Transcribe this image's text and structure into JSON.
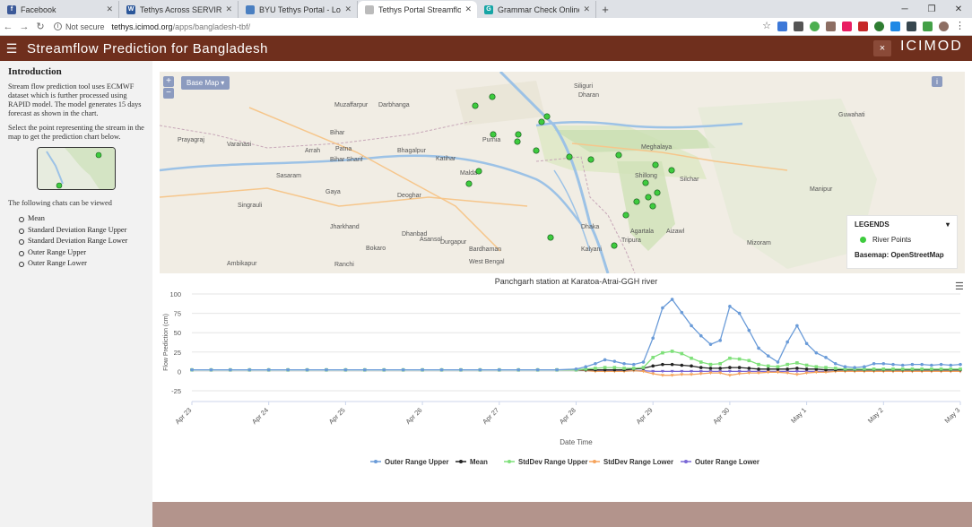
{
  "browser": {
    "tabs": [
      {
        "label": "Facebook",
        "fav_color": "#3b5998",
        "fav_glyph": "f",
        "active": false
      },
      {
        "label": "Tethys Across SERVIR - Frontiers",
        "fav_color": "#2b579a",
        "fav_glyph": "W",
        "active": false
      },
      {
        "label": "BYU Tethys Portal - Log In",
        "fav_color": "#4a7fc1",
        "fav_glyph": "",
        "active": false
      },
      {
        "label": "Tethys Portal Streamflow Predict",
        "fav_color": "#bbbbbb",
        "fav_glyph": "",
        "active": true
      },
      {
        "label": "Grammar Check Online- It's Free",
        "fav_color": "#16a5a5",
        "fav_glyph": "G",
        "active": false
      }
    ],
    "new_tab": "+",
    "window_controls": [
      "─",
      "❐",
      "✕"
    ],
    "security": "Not secure",
    "url_host": "tethys.icimod.org",
    "url_path": "/apps/bangladesh-tbf/"
  },
  "app": {
    "title": "Streamflow Prediction for Bangladesh",
    "logo": "ICIMOD",
    "close": "×"
  },
  "sidebar": {
    "heading": "Introduction",
    "para1": "Stream flow prediction tool uses ECMWF dataset which is further processed using RAPID model. The model generates 15 days forecast as shown in the chart.",
    "para2": "Select the point representing the stream in the map to get the prediction chart below.",
    "para3": "The following chats can be viewed",
    "items": [
      "Mean",
      "Standard Deviation Range Upper",
      "Standard Deviation Range Lower",
      "Outer Range Upper",
      "Outer Range Lower"
    ]
  },
  "map": {
    "zoom_in": "+",
    "zoom_out": "−",
    "base_map_label": "Base Map ▾",
    "info": "i",
    "legend_title": "LEGENDS",
    "legend_toggle": "▾",
    "legend_item": "River Points",
    "basemap_text": "Basemap: OpenStreetMap",
    "place_labels": [
      "Siliguri",
      "Dharan",
      "Muzaffarpur",
      "Darbhanga",
      "Prayagraj",
      "Varanasi",
      "Arrah",
      "Patna",
      "Bhagalpur",
      "Katihar",
      "Malda",
      "Guwahati",
      "Shillong",
      "Silchar",
      "Sasaram",
      "Gaya",
      "Deoghar",
      "Dhanbad",
      "Asansol",
      "Durgapur",
      "Bokaro",
      "Ranchi",
      "Agartala",
      "Aizawl",
      "Dhaka",
      "Bihar",
      "Meghalaya",
      "Manipur",
      "Mizoram",
      "Jharkhand",
      "West Bengal",
      "Tripura",
      "Singrauli",
      "Ambikapur",
      "Bardhaman",
      "Kalyani",
      "Bihar Sharif",
      "Purnia"
    ],
    "river_point_color": "#3ecb3e"
  },
  "chart_data": {
    "type": "line",
    "title": "Panchgarh station at Karatoa-Atrai-GGH river",
    "xlabel": "Date Time",
    "ylabel": "Flow Prediction (cm)",
    "ylim": [
      -25,
      100
    ],
    "yticks": [
      -25,
      0,
      25,
      50,
      75,
      100
    ],
    "xticks": [
      "Apr 23",
      "Apr 24",
      "Apr 25",
      "Apr 26",
      "Apr 27",
      "Apr 28",
      "Apr 29",
      "Apr 30",
      "May 1",
      "May 2",
      "May 3"
    ],
    "x_days": [
      0,
      0.25,
      0.5,
      0.75,
      1,
      1.25,
      1.5,
      1.75,
      2,
      2.25,
      2.5,
      2.75,
      3,
      3.25,
      3.5,
      3.75,
      4,
      4.25,
      4.5,
      4.75,
      5,
      5.125,
      5.25,
      5.375,
      5.5,
      5.625,
      5.75,
      5.875,
      6,
      6.125,
      6.25,
      6.375,
      6.5,
      6.625,
      6.75,
      6.875,
      7,
      7.125,
      7.25,
      7.375,
      7.5,
      7.625,
      7.75,
      7.875,
      8,
      8.125,
      8.25,
      8.375,
      8.5,
      8.625,
      8.75,
      8.875,
      9,
      9.125,
      9.25,
      9.375,
      9.5,
      9.625,
      9.75,
      9.875,
      10
    ],
    "series": [
      {
        "name": "Outer Range Upper",
        "color": "#6a9bd8",
        "values": [
          2,
          2,
          2,
          2,
          2,
          2,
          2,
          2,
          2,
          2,
          2,
          2,
          2,
          2,
          2,
          2,
          2,
          2,
          2,
          2,
          3,
          6,
          10,
          15,
          13,
          10,
          9,
          12,
          43,
          82,
          93,
          76,
          59,
          46,
          35,
          40,
          84,
          75,
          53,
          30,
          20,
          12,
          38,
          59,
          36,
          24,
          18,
          10,
          6,
          5,
          6,
          10,
          10,
          9,
          8,
          9,
          9,
          8,
          9,
          8,
          9
        ]
      },
      {
        "name": "Mean",
        "color": "#222222",
        "values": [
          2,
          2,
          2,
          2,
          2,
          2,
          2,
          2,
          2,
          2,
          2,
          2,
          2,
          2,
          2,
          2,
          2,
          2,
          2,
          2,
          2,
          2,
          2,
          2,
          2,
          2,
          3,
          4,
          7,
          9,
          9,
          8,
          7,
          5,
          4,
          4,
          5,
          5,
          4,
          3,
          3,
          3,
          3,
          4,
          3,
          3,
          2,
          2,
          2,
          2,
          2,
          2,
          2,
          2,
          2,
          2,
          2,
          2,
          2,
          2,
          2
        ]
      },
      {
        "name": "StdDev Range Upper",
        "color": "#7fe07a",
        "values": [
          2,
          2,
          2,
          2,
          2,
          2,
          2,
          2,
          2,
          2,
          2,
          2,
          2,
          2,
          2,
          2,
          2,
          2,
          2,
          2,
          2,
          3,
          4,
          5,
          5,
          4,
          4,
          5,
          18,
          24,
          26,
          23,
          17,
          12,
          9,
          10,
          17,
          16,
          14,
          9,
          7,
          6,
          9,
          11,
          8,
          6,
          5,
          4,
          3,
          3,
          3,
          3,
          3,
          3,
          3,
          3,
          3,
          3,
          3,
          3,
          3
        ]
      },
      {
        "name": "StdDev Range Lower",
        "color": "#f5a35c",
        "values": [
          2,
          2,
          2,
          2,
          2,
          2,
          2,
          2,
          2,
          2,
          2,
          2,
          2,
          2,
          2,
          2,
          2,
          2,
          2,
          2,
          2,
          1,
          0,
          0,
          0,
          0,
          1,
          0,
          -3,
          -5,
          -5,
          -4,
          -4,
          -3,
          -2,
          -2,
          -5,
          -3,
          -2,
          -2,
          -1,
          -1,
          -2,
          -4,
          -2,
          -1,
          -1,
          0,
          0,
          0,
          0,
          0,
          0,
          0,
          0,
          0,
          0,
          0,
          0,
          0,
          0
        ]
      },
      {
        "name": "Outer Range Lower",
        "color": "#7a68d6",
        "values": [
          2,
          2,
          2,
          2,
          2,
          2,
          2,
          2,
          2,
          2,
          2,
          2,
          2,
          2,
          2,
          2,
          2,
          2,
          2,
          2,
          2,
          1,
          1,
          1,
          1,
          1,
          1,
          1,
          0,
          0,
          0,
          0,
          0,
          0,
          0,
          0,
          0,
          0,
          0,
          0,
          0,
          0,
          0,
          0,
          0,
          0,
          0,
          0,
          0,
          0,
          0,
          0,
          0,
          0,
          0,
          0,
          0,
          0,
          0,
          0,
          0
        ]
      }
    ],
    "legend_position": "bottom"
  }
}
